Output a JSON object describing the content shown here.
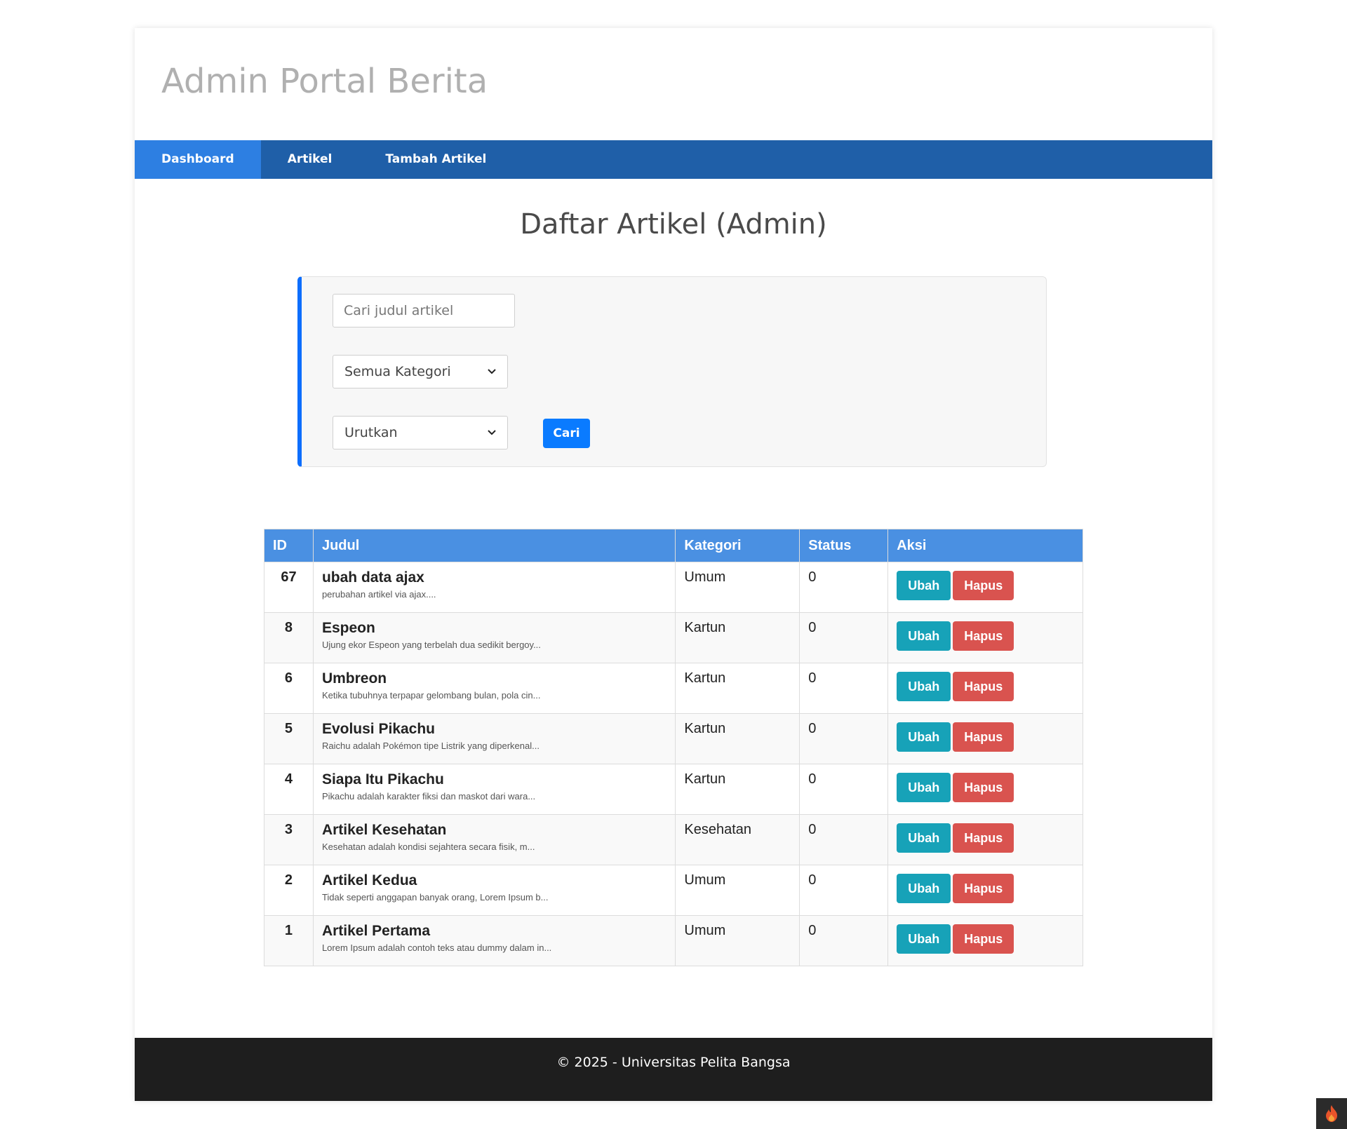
{
  "header": {
    "title": "Admin Portal Berita"
  },
  "nav": {
    "items": [
      {
        "label": "Dashboard",
        "active": true
      },
      {
        "label": "Artikel",
        "active": false
      },
      {
        "label": "Tambah Artikel",
        "active": false
      }
    ]
  },
  "main": {
    "title": "Daftar Artikel (Admin)",
    "filters": {
      "search_placeholder": "Cari judul artikel",
      "kategori_value": "Semua Kategori",
      "urutkan_value": "Urutkan",
      "cari_label": "Cari"
    },
    "table": {
      "headers": [
        "ID",
        "Judul",
        "Kategori",
        "Status",
        "Aksi"
      ],
      "rows": [
        {
          "id": "67",
          "title": "ubah data ajax",
          "excerpt": "perubahan artikel via ajax....",
          "kategori": "Umum",
          "status": "0"
        },
        {
          "id": "8",
          "title": "Espeon",
          "excerpt": "Ujung ekor Espeon yang terbelah dua sedikit bergoy...",
          "kategori": "Kartun",
          "status": "0"
        },
        {
          "id": "6",
          "title": "Umbreon",
          "excerpt": "Ketika tubuhnya terpapar gelombang bulan, pola cin...",
          "kategori": "Kartun",
          "status": "0"
        },
        {
          "id": "5",
          "title": "Evolusi Pikachu",
          "excerpt": "Raichu adalah Pokémon tipe Listrik yang diperkenal...",
          "kategori": "Kartun",
          "status": "0"
        },
        {
          "id": "4",
          "title": "Siapa Itu Pikachu",
          "excerpt": "Pikachu adalah karakter fiksi dan maskot dari wara...",
          "kategori": "Kartun",
          "status": "0"
        },
        {
          "id": "3",
          "title": "Artikel Kesehatan",
          "excerpt": "Kesehatan adalah kondisi sejahtera secara fisik, m...",
          "kategori": "Kesehatan",
          "status": "0"
        },
        {
          "id": "2",
          "title": "Artikel Kedua",
          "excerpt": "Tidak seperti anggapan banyak orang, Lorem Ipsum b...",
          "kategori": "Umum",
          "status": "0"
        },
        {
          "id": "1",
          "title": "Artikel Pertama",
          "excerpt": "Lorem Ipsum adalah contoh teks atau dummy dalam in...",
          "kategori": "Umum",
          "status": "0"
        }
      ],
      "ubah_label": "Ubah",
      "hapus_label": "Hapus"
    }
  },
  "footer": {
    "text": "© 2025 - Universitas Pelita Bangsa"
  },
  "colors": {
    "nav_bg": "#1f5fa8",
    "nav_active": "#2d7fe2",
    "table_header": "#4a90e2",
    "btn_primary": "#0a7bff",
    "btn_ubah": "#17a2b8",
    "btn_hapus": "#d9534f",
    "footer_bg": "#1e1e1e"
  },
  "icons": {
    "corner_badge": "flame-icon"
  }
}
